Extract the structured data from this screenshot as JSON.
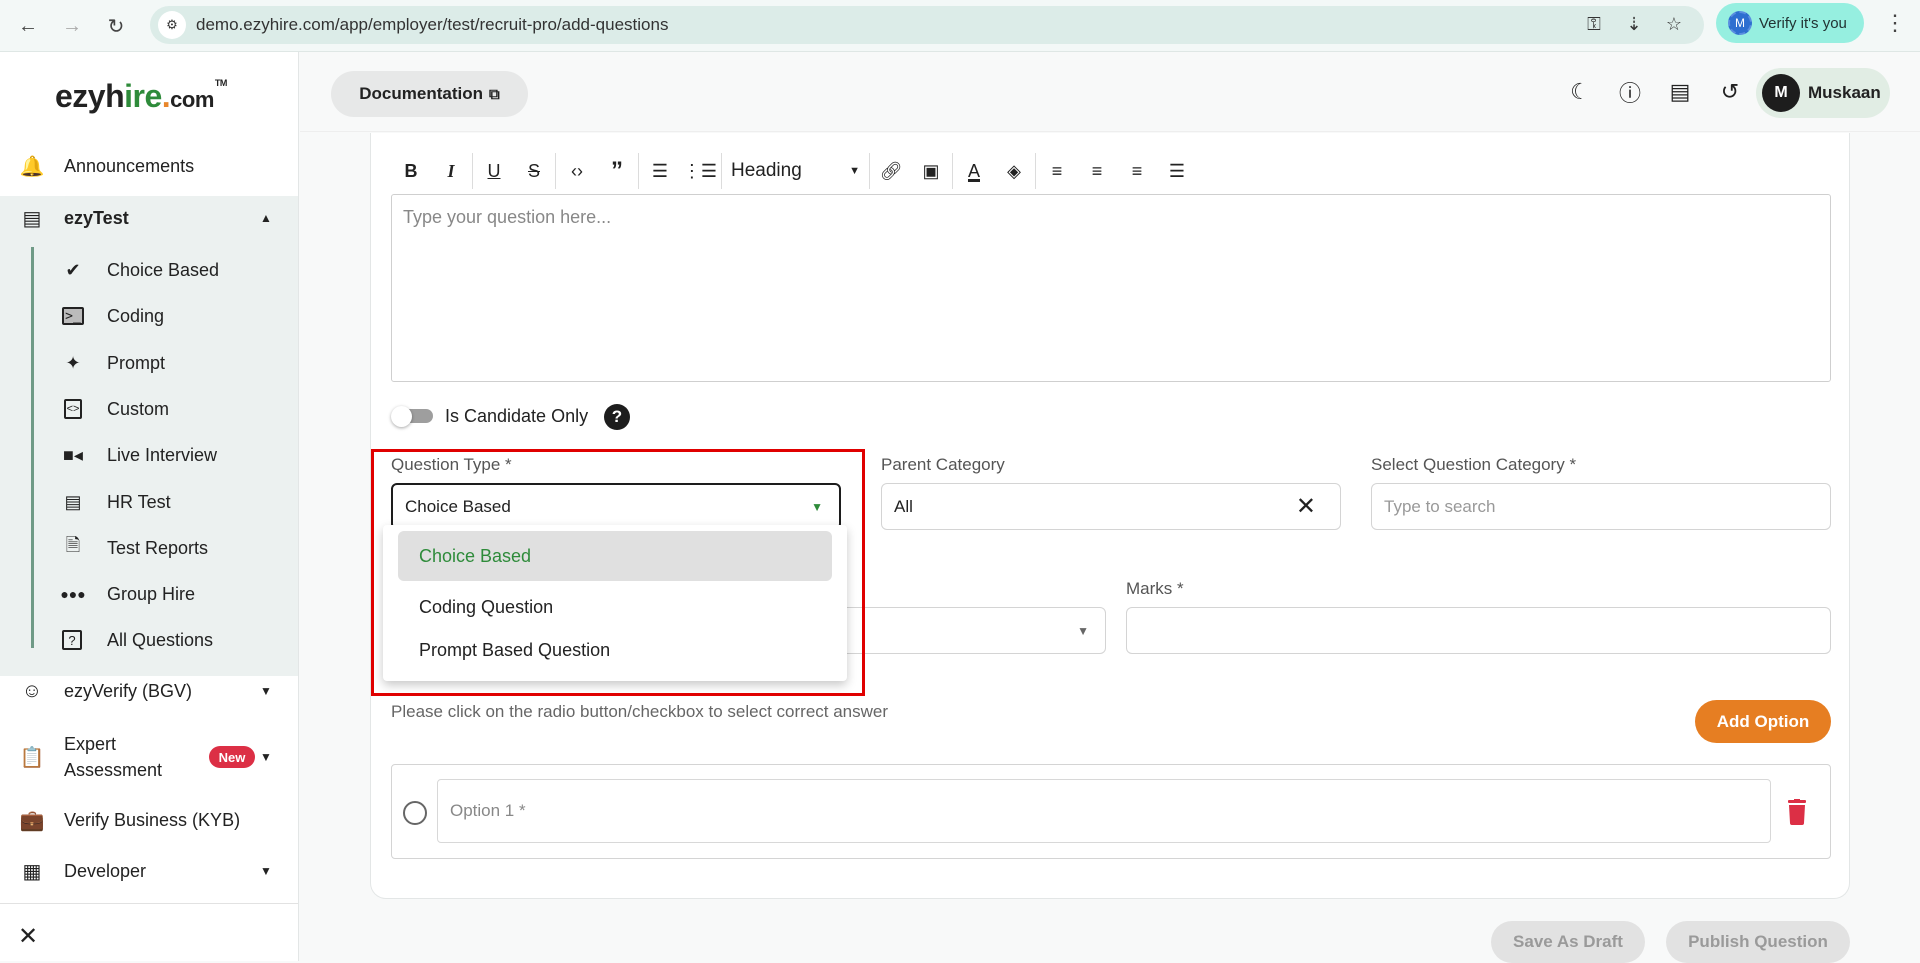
{
  "browser": {
    "url": "demo.ezyhire.com/app/employer/test/recruit-pro/add-questions",
    "verify_label": "Verify it's you",
    "verify_avatar": "M",
    "icons": [
      "back-icon",
      "forward-icon",
      "reload-icon",
      "site-settings-icon",
      "password-key-icon",
      "install-app-icon",
      "bookmark-star-icon",
      "chrome-menu-icon"
    ]
  },
  "logo": {
    "part1": "ezyh",
    "part2": "ir",
    "part3": "e",
    "dot": ".",
    "com": "com",
    "tm": "TM"
  },
  "sidebar": {
    "announcements": "Announcements",
    "ezytest": {
      "label": "ezyTest",
      "items": [
        {
          "label": "Choice Based",
          "icon": "check-circle-icon"
        },
        {
          "label": "Coding",
          "icon": "terminal-icon"
        },
        {
          "label": "Prompt",
          "icon": "sparkles-icon"
        },
        {
          "label": "Custom",
          "icon": "code-clipboard-icon"
        },
        {
          "label": "Live Interview",
          "icon": "video-camera-icon"
        },
        {
          "label": "HR Test",
          "icon": "chat-bubbles-icon"
        },
        {
          "label": "Test Reports",
          "icon": "report-icon"
        },
        {
          "label": "Group Hire",
          "icon": "group-icon"
        },
        {
          "label": "All Questions",
          "icon": "question-library-icon"
        }
      ]
    },
    "ezyverify": "ezyVerify (BGV)",
    "expert_line1": "Expert",
    "expert_line2": "Assessment",
    "new_badge": "New",
    "verify_business": "Verify Business (KYB)",
    "developer": "Developer"
  },
  "header": {
    "documentation": "Documentation",
    "user_initial": "M",
    "user_name": "Muskaan"
  },
  "editor": {
    "heading_select": "Heading",
    "placeholder": "Type your question here...",
    "toolbar": [
      "bold",
      "italic",
      "underline",
      "strikethrough",
      "code",
      "quote",
      "ordered-list",
      "bullet-list",
      "heading",
      "link",
      "image",
      "text-color",
      "fill-color",
      "align-left",
      "align-center",
      "align-right",
      "align-justify"
    ]
  },
  "form": {
    "candidate_only_label": "Is Candidate Only",
    "candidate_only_value": false,
    "question_type_label": "Question Type *",
    "question_type_value": "Choice Based",
    "question_type_options": [
      "Choice Based",
      "Coding Question",
      "Prompt Based Question"
    ],
    "parent_category_label": "Parent Category",
    "parent_category_value": "All",
    "question_category_label": "Select Question Category *",
    "question_category_placeholder": "Type to search",
    "marks_label": "Marks *",
    "marks_value": "",
    "hint": "Please click on the radio button/checkbox to select correct answer",
    "add_option": "Add Option",
    "option1_placeholder": "Option 1 *"
  },
  "footer": {
    "save_draft": "Save As Draft",
    "publish": "Publish Question"
  },
  "colors": {
    "brand_green": "#2e8b3a",
    "accent_orange": "#e67e22",
    "danger_red": "#dc2f45",
    "highlight_red": "#e00000"
  }
}
